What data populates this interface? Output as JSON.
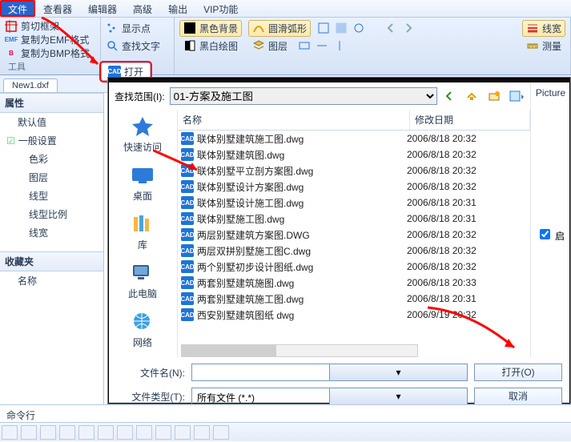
{
  "menu": {
    "items": [
      "文件",
      "查看器",
      "编辑器",
      "高级",
      "输出",
      "VIP功能"
    ],
    "active_index": 0
  },
  "ribbon": {
    "left": {
      "crop_frame": "剪切框架",
      "copy_emf": "复制为EMF格式",
      "copy_bmp": "复制为BMP格式",
      "tools_tab": "工具"
    },
    "center": {
      "show_points": "显示点",
      "find_text": "查找文字"
    },
    "right_buttons": {
      "black_bg": "黑色背景",
      "smooth_arc": "圆滑弧形",
      "mono_draw": "黑白绘图",
      "layers": "图层",
      "line_width": "线宽",
      "measure": "测量"
    },
    "open_popup": "打开"
  },
  "tabs": {
    "active": "New1.dxf"
  },
  "left_panel": {
    "attributes": "属性",
    "defaults": "默认值",
    "general": "一般设置",
    "items": [
      "色彩",
      "图层",
      "线型",
      "线型比例",
      "线宽"
    ],
    "favorites": "收藏夹",
    "name": "名称"
  },
  "dialog": {
    "range_label": "查找范围(I):",
    "folder": "01-方案及施工图",
    "places": {
      "quick": "快速访问",
      "desktop": "桌面",
      "library": "库",
      "thispc": "此电脑",
      "network": "网络"
    },
    "columns": {
      "name": "名称",
      "date": "修改日期"
    },
    "files": [
      {
        "name": "联体别墅建筑施工图.dwg",
        "date": "2006/8/18 20:32"
      },
      {
        "name": "联体别墅建筑图.dwg",
        "date": "2006/8/18 20:32"
      },
      {
        "name": "联体别墅平立剖方案图.dwg",
        "date": "2006/8/18 20:32"
      },
      {
        "name": "联体别墅设计方案图.dwg",
        "date": "2006/8/18 20:32"
      },
      {
        "name": "联体别墅设计施工图.dwg",
        "date": "2006/8/18 20:31"
      },
      {
        "name": "联体别墅施工图.dwg",
        "date": "2006/8/18 20:31"
      },
      {
        "name": "两层别墅建筑方案图.DWG",
        "date": "2006/8/18 20:32"
      },
      {
        "name": "两层双拼别墅施工图C.dwg",
        "date": "2006/8/18 20:32"
      },
      {
        "name": "两个别墅初步设计图纸.dwg",
        "date": "2006/8/18 20:32"
      },
      {
        "name": "两套别墅建筑施图.dwg",
        "date": "2006/8/18 20:33"
      },
      {
        "name": "两套别墅建筑施工图.dwg",
        "date": "2006/8/18 20:31"
      },
      {
        "name": "西安别墅建筑图纸 dwg",
        "date": "2006/9/19 20:32"
      }
    ],
    "side": {
      "preview": "Picture",
      "enable_checkbox": "启"
    },
    "filename_label": "文件名(N):",
    "filename_value": "",
    "filetype_label": "文件类型(T):",
    "filetype_value": "所有文件 (*.*)",
    "open_btn": "打开(O)",
    "cancel_btn": "取消"
  },
  "footer": {
    "commandline": "命令行",
    "cells": 12
  }
}
